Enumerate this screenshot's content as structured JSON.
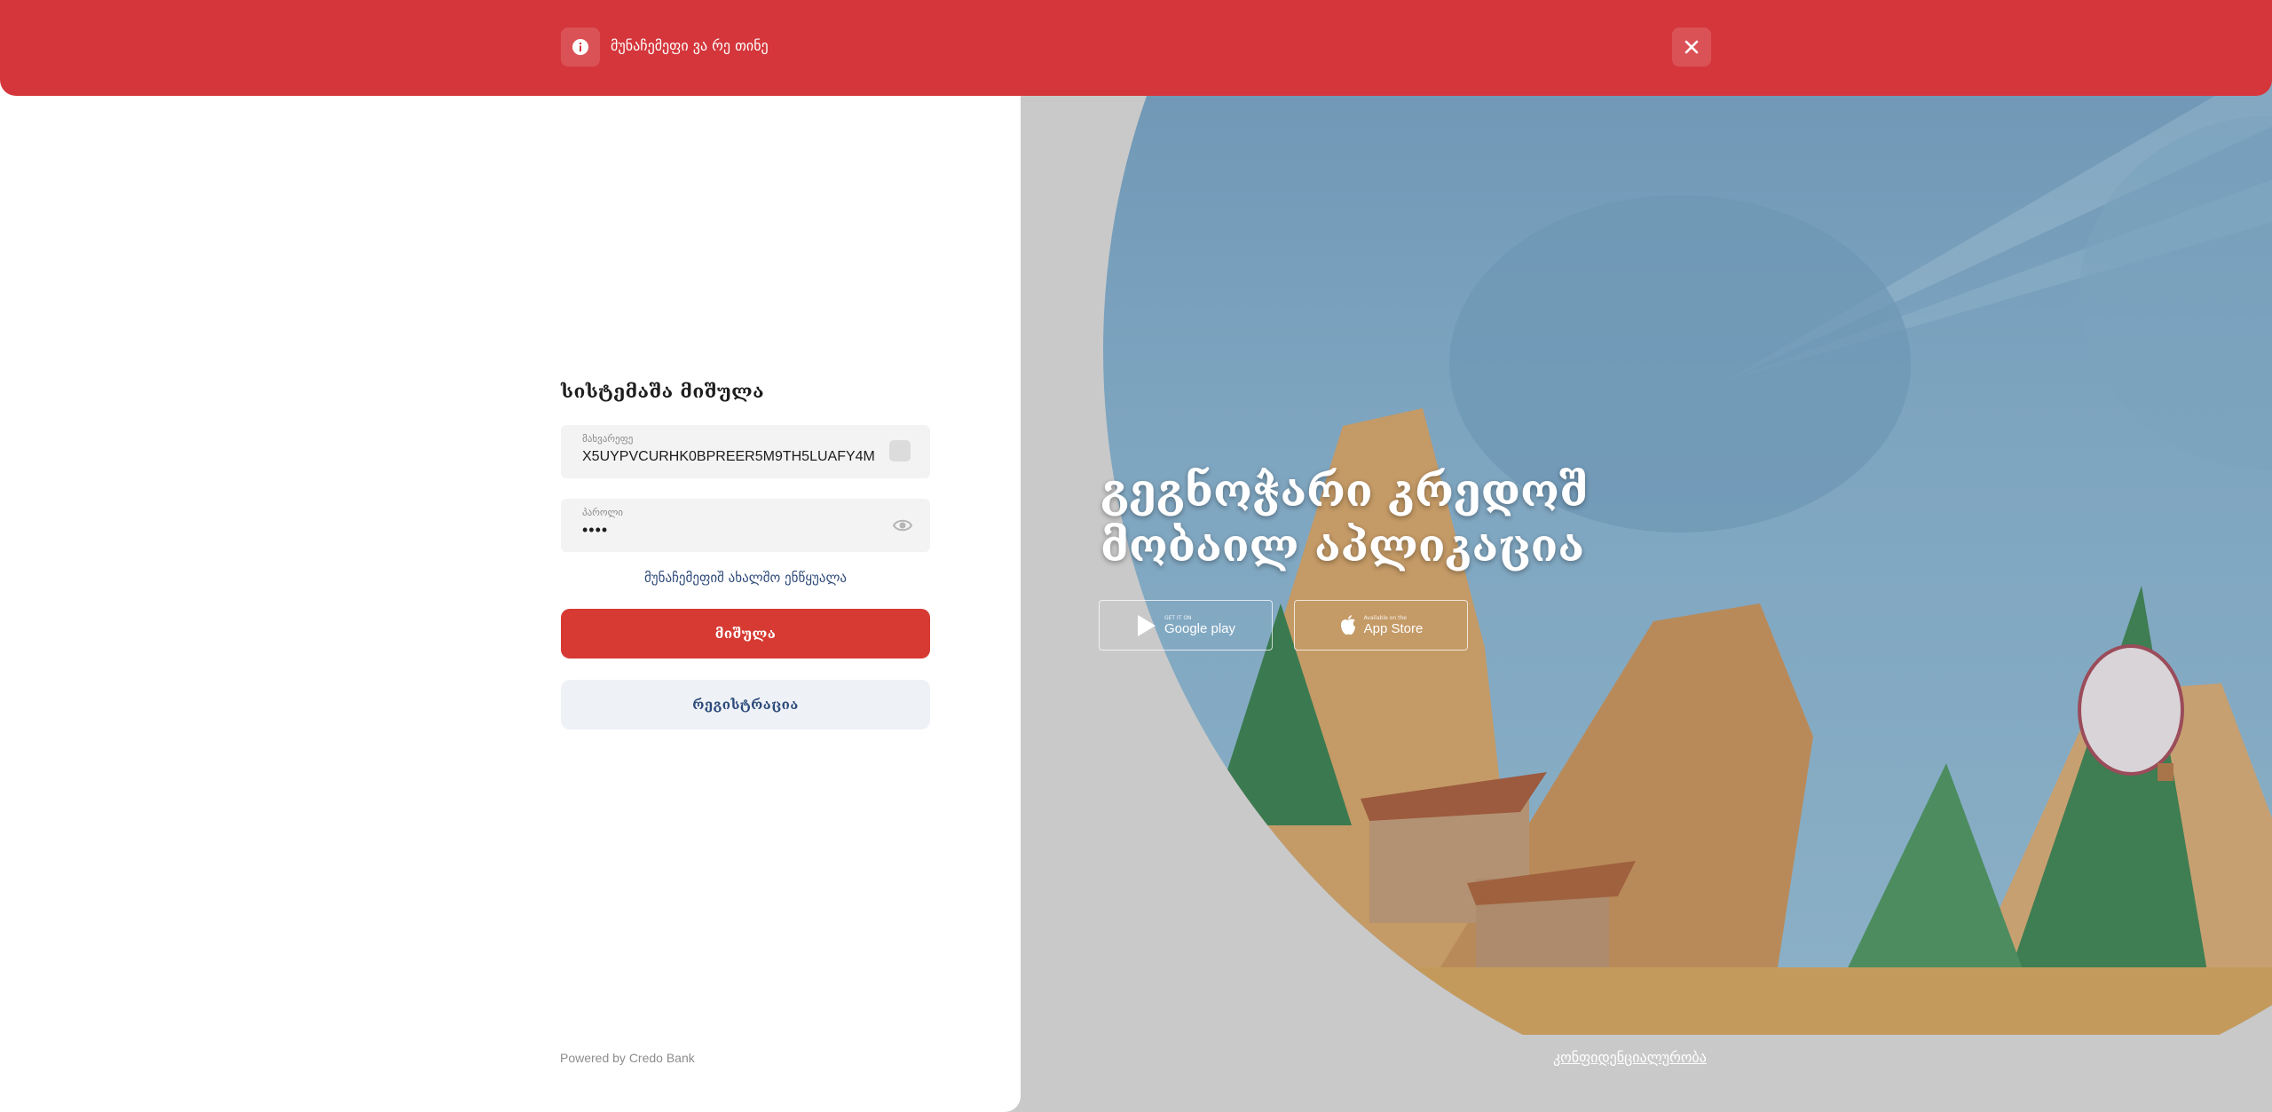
{
  "banner": {
    "message": "მუნაჩემეფი ვა რე თინე",
    "icon": "info-icon",
    "close_icon": "close-icon",
    "color": "#d4363b"
  },
  "login": {
    "title": "სისტემაშა მიშულა",
    "username_label": "მახვარეფე",
    "username_value": "X5UYPVCURHK0BPREER5M9TH5LUAFY4M",
    "password_label": "პაროლი",
    "password_value": "••••",
    "forgot_link": "მუნაჩემეფიშ ახალშო ენწყუალა",
    "login_button": "მიშულა",
    "register_button": "რეგისტრაცია",
    "accent_color": "#d63a33"
  },
  "footer": {
    "powered_by": "Powered by Credo Bank",
    "privacy_link": "კონფიდენციალურობა"
  },
  "promo": {
    "title_line1": "გეგნოჭარი კრედოშ",
    "title_line2": "მობაილ აპლიკაცია",
    "google_small": "GET IT ON",
    "google_big": "Google play",
    "apple_small": "Available on the",
    "apple_big": "App Store"
  }
}
